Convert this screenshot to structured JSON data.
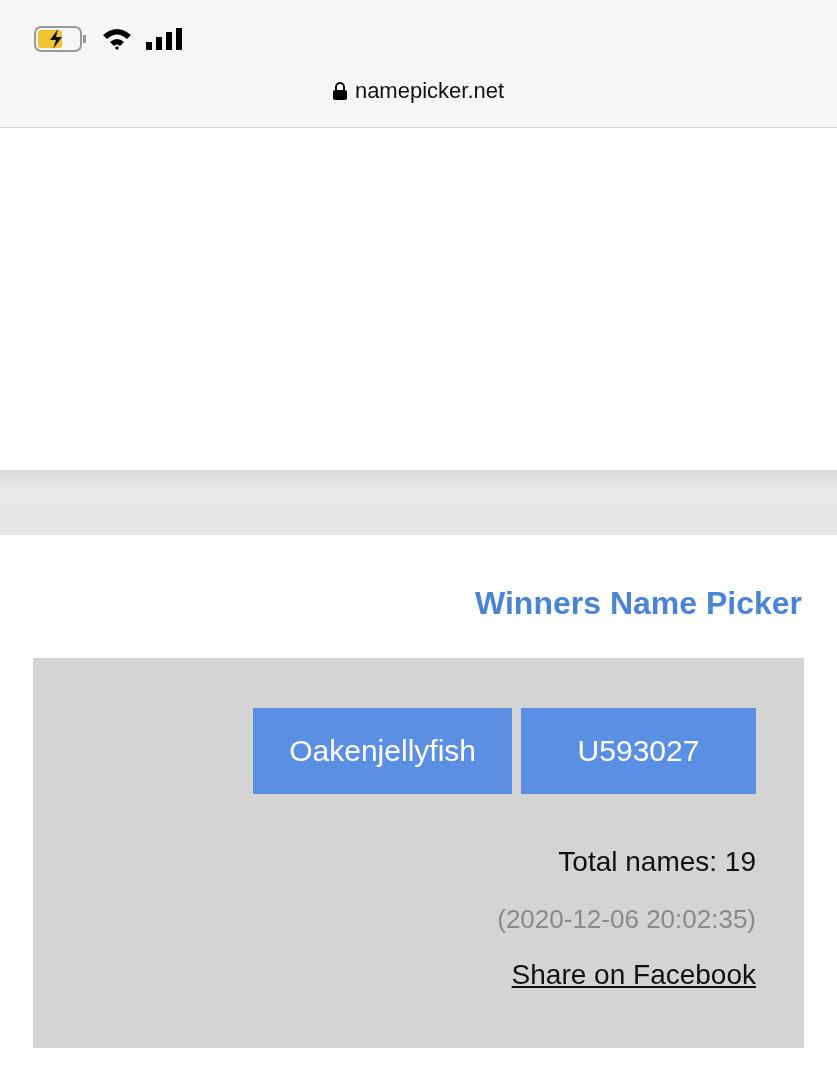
{
  "browser_bar": {
    "url": "namepicker.net"
  },
  "picker": {
    "title": "Winners Name Picker",
    "winners": [
      "Oakenjellyfish",
      "U593027"
    ],
    "total": "Total names: 19",
    "timestamp": "(2020-12-06 20:02:35)",
    "share_link": "Share on Facebook"
  }
}
